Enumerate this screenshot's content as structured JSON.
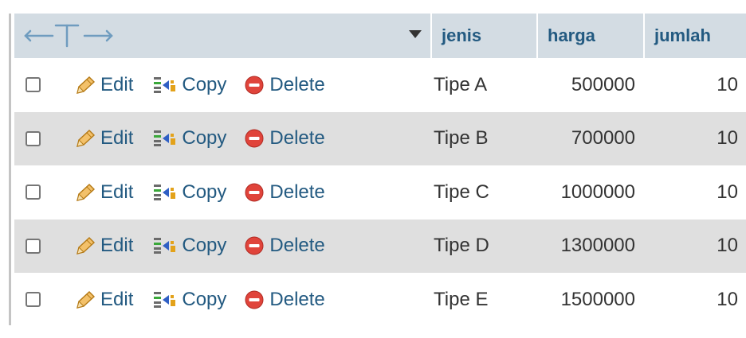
{
  "table": {
    "columns": [
      {
        "key": "jenis",
        "label": "jenis"
      },
      {
        "key": "harga",
        "label": "harga"
      },
      {
        "key": "jumlah",
        "label": "jumlah"
      }
    ],
    "actions": {
      "edit": "Edit",
      "copy": "Copy",
      "delete": "Delete"
    },
    "sort_icon": "sort-desc-triangle-icon",
    "toggle_icon": "left-right-column-arrows-icon",
    "rows": [
      {
        "jenis": "Tipe A",
        "harga": "500000",
        "jumlah": "10"
      },
      {
        "jenis": "Tipe B",
        "harga": "700000",
        "jumlah": "10"
      },
      {
        "jenis": "Tipe C",
        "harga": "1000000",
        "jumlah": "10"
      },
      {
        "jenis": "Tipe D",
        "harga": "1300000",
        "jumlah": "10"
      },
      {
        "jenis": "Tipe E",
        "harga": "1500000",
        "jumlah": "10"
      }
    ]
  },
  "colors": {
    "header_bg": "#d3dce3",
    "link": "#235a81",
    "row_alt": "#dfdfdf",
    "delete_red": "#e0443b"
  }
}
